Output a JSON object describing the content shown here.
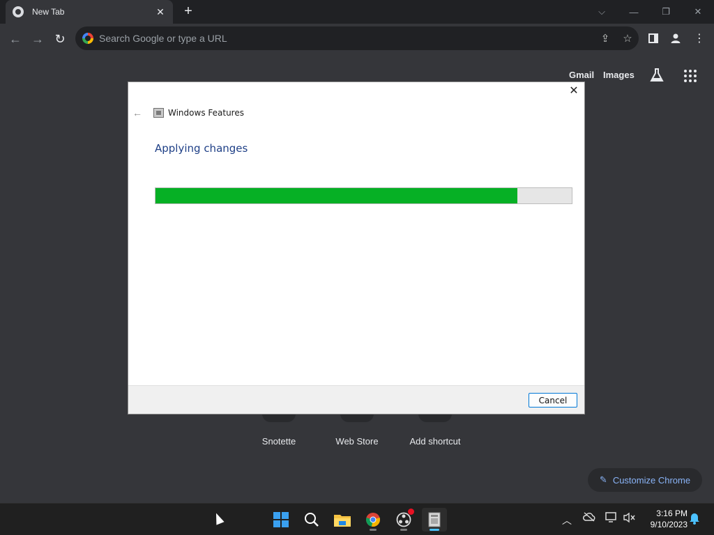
{
  "browser": {
    "tab_title": "New Tab",
    "omnibox_placeholder": "Search Google or type a URL"
  },
  "ntp": {
    "gmail_label": "Gmail",
    "images_label": "Images",
    "shortcuts": [
      "Snotette",
      "Web Store",
      "Add shortcut"
    ],
    "customize_label": "Customize Chrome"
  },
  "dialog": {
    "title": "Windows Features",
    "heading": "Applying changes",
    "progress": 0.87,
    "cancel_label": "Cancel"
  },
  "taskbar": {
    "time": "3:16 PM",
    "date": "9/10/2023"
  },
  "colors": {
    "progress_fill": "#06b025",
    "link_blue": "#8ab4f8",
    "dialog_heading": "#1e3f86"
  }
}
